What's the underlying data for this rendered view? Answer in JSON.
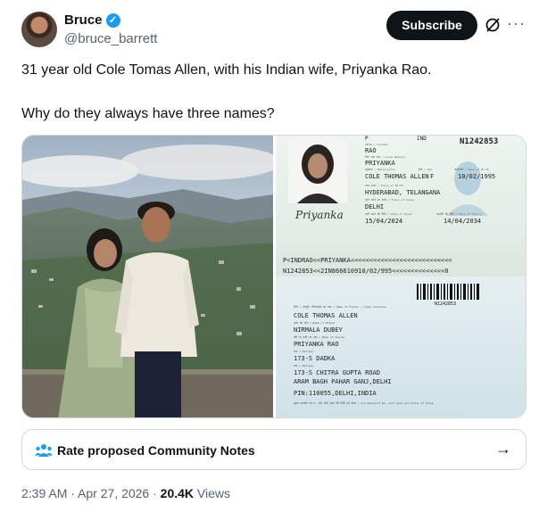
{
  "author": {
    "name": "Bruce",
    "handle": "@bruce_barrett"
  },
  "actions": {
    "subscribe": "Subscribe",
    "more": "···"
  },
  "post": {
    "line1": "31 year old Cole Tomas Allen, with his Indian wife, Priyanka Rao.",
    "line2": "Why do they always have three names?"
  },
  "passport": {
    "top": {
      "type": "P",
      "code": "IND",
      "number": "N1242853",
      "surname_label": "उपनाम / Surname",
      "surname": "RAO",
      "given_label": "दिया गया नाम / Given Name(s)",
      "given": "PRIYANKA",
      "nationality_label": "राष्ट्रीयता / Nationality",
      "sex_label": "लिंग / Sex",
      "dob_label": "जन्मतिथि / Date of Birth",
      "nationality_value": "COLE THOMAS ALLEN",
      "sex_value": "F",
      "dob": "10/02/1995",
      "pob_label": "जन्म स्थान / Place of Birth",
      "pob": "HYDERABAD, TELANGANA",
      "poi_label": "जारी करने का स्थान / Place of Issue",
      "poi": "DELHI",
      "doi_label": "जारी करने की तिथि / Date of Issue",
      "doe_label": "समाप्ति की तिथि / Date of Expiry",
      "doi": "15/04/2024",
      "doe": "14/04/2034",
      "signature": "Priyanka",
      "mrz1": "P<INDRAO<<PRIYANKA<<<<<<<<<<<<<<<<<<<<<<<<<<<",
      "mrz2": "N1242853<<2IN866610910/02/995<<<<<<<<<<<<<<0"
    },
    "bottom": {
      "number": "N1242853",
      "father_label": "पिता / कानूनी अभिभावक का नाम / Name of Father / Legal Guardian",
      "father": "COLE THOMAS ALLEN",
      "mother_label": "माता का नाम / Name of Mother",
      "mother": "NIRMALA DUBEY",
      "spouse_label": "पति या पत्नी का नाम / Name of Spouse",
      "spouse": "PRIYANKA RAO",
      "address_label": "पता / Address",
      "address1": "173-S DADKA",
      "address2_label": "पता / Address",
      "address2": "173-S CHITRA GUPTA ROAD",
      "address3": "ARAM BAGH PAHAR GANJ,DELHI",
      "pin": "PIN:110055,DELHI,INDIA",
      "old_passport_label": "पुराने पासपोर्ट का नं. और जारी करने की तिथि एवं स्थान / Old Passport No. with Date and Place of Issue"
    }
  },
  "community_notes": {
    "label": "Rate proposed Community Notes",
    "arrow": "→"
  },
  "meta": {
    "time": "2:39 AM",
    "sep1": " · ",
    "date": "Apr 27, 2026",
    "sep2": " · ",
    "views": "20.4K",
    "views_label": " Views"
  },
  "colors": {
    "accent": "#1d9bf0",
    "text": "#0f1419",
    "muted": "#536471",
    "border": "#cfd9de"
  }
}
